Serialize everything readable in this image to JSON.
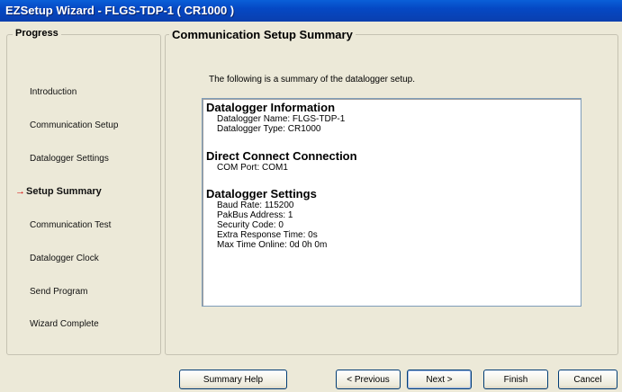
{
  "window": {
    "title": "EZSetup Wizard - FLGS-TDP-1 ( CR1000 )"
  },
  "progress": {
    "legend": "Progress",
    "current_marker": "→",
    "steps": [
      {
        "label": "Introduction"
      },
      {
        "label": "Communication Setup"
      },
      {
        "label": "Datalogger Settings"
      },
      {
        "label": "Setup Summary"
      },
      {
        "label": "Communication Test"
      },
      {
        "label": "Datalogger Clock"
      },
      {
        "label": "Send Program"
      },
      {
        "label": "Wizard Complete"
      }
    ]
  },
  "summary": {
    "legend": "Communication Setup Summary",
    "intro": "The following is a summary of the datalogger setup.",
    "sections": [
      {
        "heading": "Datalogger Information",
        "lines": [
          "Datalogger Name: FLGS-TDP-1",
          "Datalogger Type: CR1000"
        ]
      },
      {
        "heading": "Direct Connect Connection",
        "lines": [
          "COM Port: COM1"
        ]
      },
      {
        "heading": "Datalogger Settings",
        "lines": [
          "Baud Rate: 115200",
          "PakBus Address: 1",
          "Security Code: 0",
          "Extra Response Time: 0s",
          "Max Time Online: 0d 0h 0m"
        ]
      }
    ]
  },
  "buttons": {
    "summary_help": "Summary Help",
    "previous": "< Previous",
    "next": "Next >",
    "finish": "Finish",
    "cancel": "Cancel"
  }
}
